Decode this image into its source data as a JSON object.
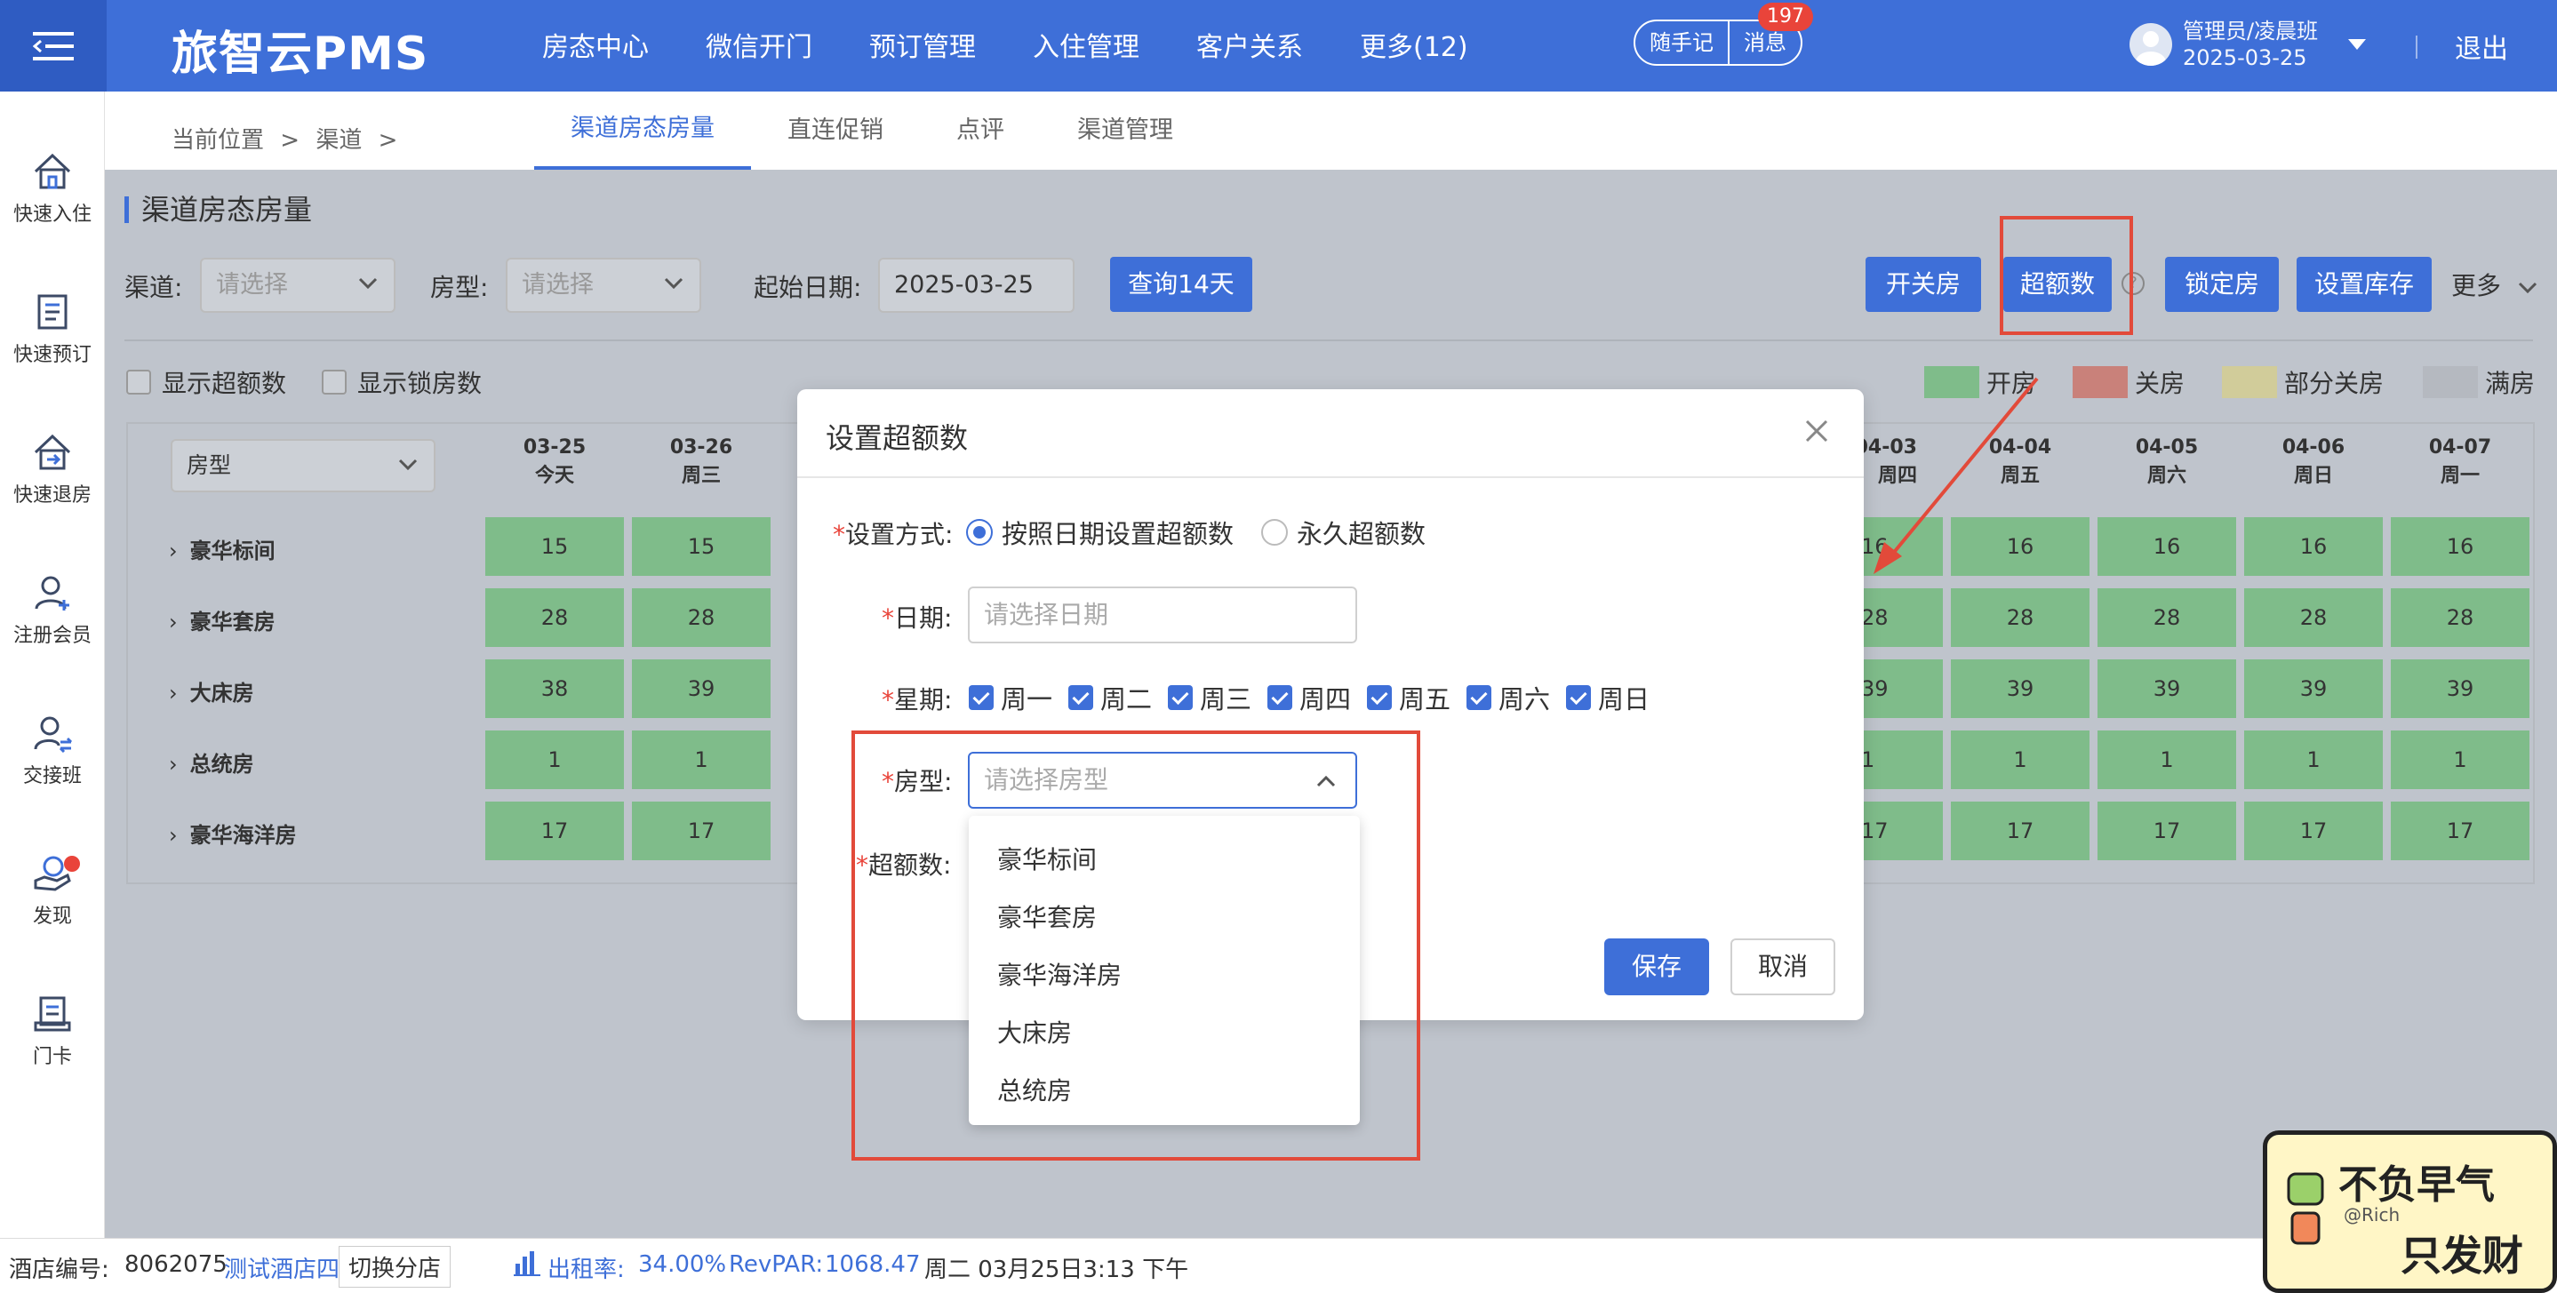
{
  "app": {
    "title": "旅智云PMS",
    "nav": [
      "房态中心",
      "微信开门",
      "预订管理",
      "入住管理",
      "客户关系",
      "更多(12)"
    ],
    "notes_label": "随手记",
    "messages_label": "消息",
    "messages_badge": "197",
    "user_name": "管理员/凌晨班",
    "user_date": "2025-03-25",
    "logout_label": "退出"
  },
  "sidebar": [
    "快速入住",
    "快速预订",
    "快速退房",
    "注册会员",
    "交接班",
    "发现",
    "门卡"
  ],
  "breadcrumb": {
    "current": "当前位置",
    "sep": ">",
    "channel": "渠道"
  },
  "tabs": [
    "渠道房态房量",
    "直连促销",
    "点评",
    "渠道管理"
  ],
  "section_title": "渠道房态房量",
  "filters": {
    "channel_label": "渠道:",
    "channel_placeholder": "请选择",
    "roomtype_label": "房型:",
    "roomtype_placeholder": "请选择",
    "startdate_label": "起始日期:",
    "startdate_value": "2025-03-25",
    "query_button": "查询14天"
  },
  "actions": {
    "toggle_room": "开关房",
    "overbook": "超额数",
    "help": "?",
    "lock_room": "锁定房",
    "set_stock": "设置库存",
    "more": "更多"
  },
  "checkboxes": [
    "显示超额数",
    "显示锁房数"
  ],
  "legend": [
    {
      "label": "开房",
      "color": "#7fbc8a"
    },
    {
      "label": "关房",
      "color": "#c9817a"
    },
    {
      "label": "部分关房",
      "color": "#d1cc9a"
    },
    {
      "label": "满房",
      "color": "#b5b9c0"
    }
  ],
  "grid": {
    "roomtype_select_label": "房型",
    "dates": [
      {
        "date": "03-25",
        "day": "今天"
      },
      {
        "date": "03-26",
        "day": "周三"
      },
      {
        "date": "04-03",
        "day": "周四"
      },
      {
        "date": "04-04",
        "day": "周五"
      },
      {
        "date": "04-05",
        "day": "周六"
      },
      {
        "date": "04-06",
        "day": "周日"
      },
      {
        "date": "04-07",
        "day": "周一"
      }
    ],
    "rows": [
      {
        "name": "豪华标间",
        "left": [
          "15",
          "15"
        ],
        "right": [
          "16",
          "16",
          "16",
          "16",
          "16"
        ]
      },
      {
        "name": "豪华套房",
        "left": [
          "28",
          "28"
        ],
        "right": [
          "28",
          "28",
          "28",
          "28",
          "28"
        ]
      },
      {
        "name": "大床房",
        "left": [
          "38",
          "39"
        ],
        "right": [
          "39",
          "39",
          "39",
          "39",
          "39"
        ]
      },
      {
        "name": "总统房",
        "left": [
          "1",
          "1"
        ],
        "right": [
          "1",
          "1",
          "1",
          "1",
          "1"
        ]
      },
      {
        "name": "豪华海洋房",
        "left": [
          "17",
          "17"
        ],
        "right": [
          "17",
          "17",
          "17",
          "17",
          "17"
        ]
      }
    ]
  },
  "modal": {
    "title": "设置超额数",
    "required_mark": "*",
    "mode_label": "设置方式:",
    "mode_options": [
      "按照日期设置超额数",
      "永久超额数"
    ],
    "date_label": "日期:",
    "date_placeholder": "请选择日期",
    "week_label": "星期:",
    "weekdays": [
      "周一",
      "周二",
      "周三",
      "周四",
      "周五",
      "周六",
      "周日"
    ],
    "roomtype_label": "房型:",
    "roomtype_placeholder": "请选择房型",
    "overbook_label": "超额数:",
    "save": "保存",
    "cancel": "取消",
    "dropdown_options": [
      "豪华标间",
      "豪华套房",
      "豪华海洋房",
      "大床房",
      "总统房"
    ]
  },
  "status": {
    "hotel_no_label": "酒店编号:",
    "hotel_no": "8062075",
    "hotel_name": "测试酒店四",
    "switch_label": "切换分店",
    "occupancy_label": "出租率:",
    "occupancy": "34.00%",
    "revpar_label": "RevPAR:",
    "revpar": "1068.47",
    "datetime": "周二 03月25日3:13 下午"
  },
  "sticker": {
    "line1": "不负早气",
    "line2": "只发财",
    "tag": "@Rich"
  }
}
